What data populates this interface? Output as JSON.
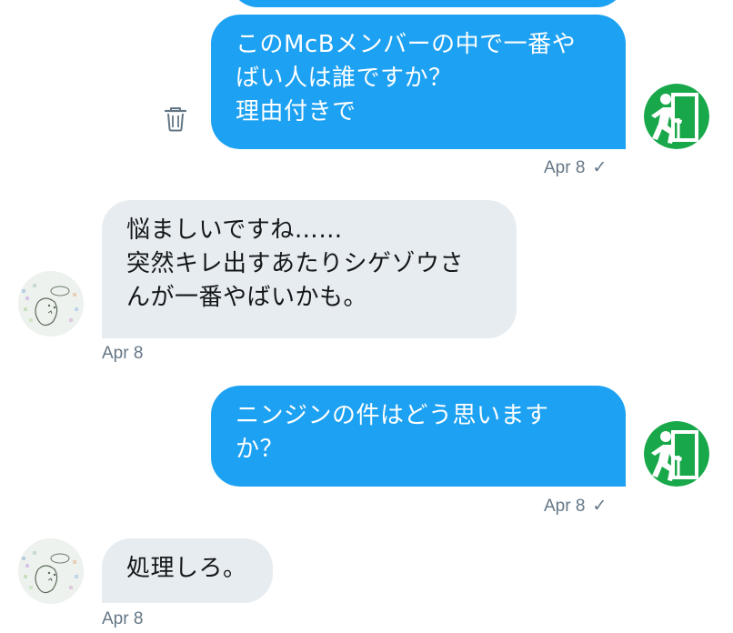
{
  "messages": [
    {
      "id": "m1",
      "direction": "out",
      "text": "このMcBメンバーの中で一番や\nばい人は誰ですか？\n理由付きで",
      "timestamp": "Apr 8",
      "status": "✓"
    },
    {
      "id": "m2",
      "direction": "in",
      "text": "悩ましいですね……\n突然キレ出すあたりシゲゾウさ\nんが一番やばいかも。",
      "timestamp": "Apr 8"
    },
    {
      "id": "m3",
      "direction": "out",
      "text": "ニンジンの件はどう思います\nか？",
      "timestamp": "Apr 8",
      "status": "✓"
    },
    {
      "id": "m4",
      "direction": "in",
      "text": "処理しろ。",
      "timestamp": "Apr 8"
    }
  ],
  "colors": {
    "outgoing_bubble": "#1da1f2",
    "incoming_bubble": "#e6ecf0",
    "meta_text": "#657786",
    "exit_sign_green": "#18a84a"
  },
  "icons": {
    "delete": "trash-icon",
    "sent_status": "checkmark-icon",
    "user_avatar": "emergency-exit-icon"
  }
}
